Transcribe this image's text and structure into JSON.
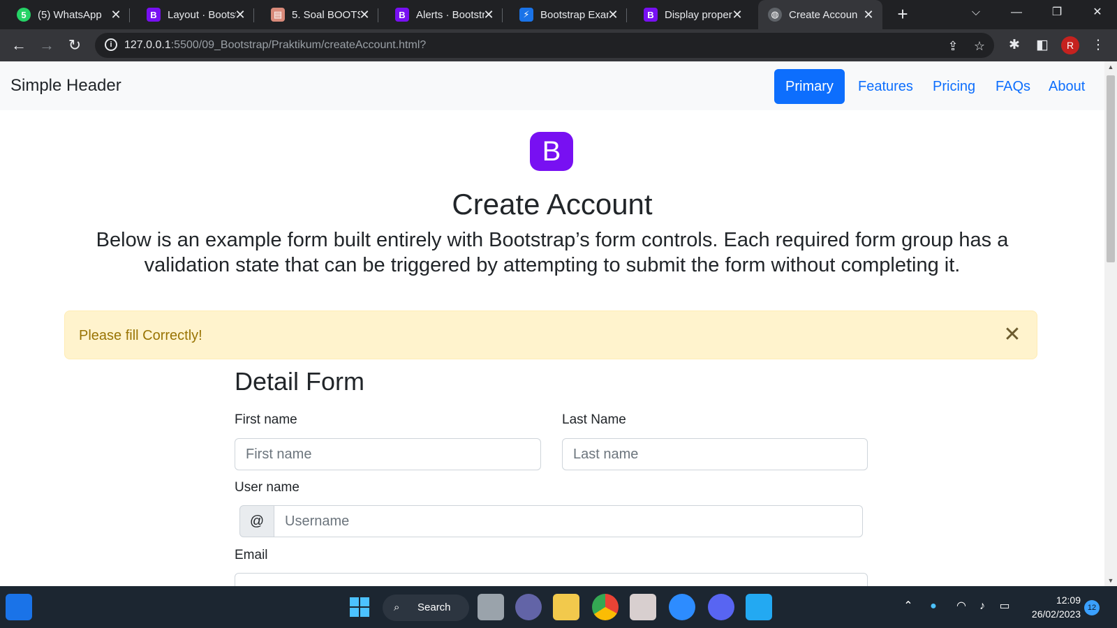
{
  "browser": {
    "tabs": [
      {
        "title": "(5) WhatsApp",
        "icon": "whatsapp-icon",
        "color": "#25d366",
        "glyph": "5"
      },
      {
        "title": "Layout · Bootst",
        "icon": "bootstrap-icon",
        "color": "#7810f2",
        "glyph": "B"
      },
      {
        "title": "5. Soal BOOTST",
        "icon": "document-icon",
        "color": "#d98a7a",
        "glyph": "▤"
      },
      {
        "title": "Alerts · Bootstr",
        "icon": "bootstrap-icon",
        "color": "#7810f2",
        "glyph": "B"
      },
      {
        "title": "Bootstrap Exan",
        "icon": "lightning-icon",
        "color": "#1a73e8",
        "glyph": "⚡"
      },
      {
        "title": "Display proper",
        "icon": "bootstrap-icon",
        "color": "#7810f2",
        "glyph": "B"
      },
      {
        "title": "Create Accoun",
        "icon": "globe-icon",
        "color": "#5f6368",
        "glyph": "◍"
      }
    ],
    "url_host": "127.0.0.1",
    "url_rest": ":5500/09_Bootstrap/Praktikum/createAccount.html?",
    "profile_initial": "R"
  },
  "page": {
    "brand": "Simple Header",
    "nav": [
      "Primary",
      "Features",
      "Pricing",
      "FAQs",
      "About"
    ],
    "logo_letter": "B",
    "title": "Create Account",
    "lead": "Below is an example form built entirely with Bootstrap’s form controls. Each required form group has a validation state that can be triggered by attempting to submit the form without completing it.",
    "alert_text": "Please fill Correctly!",
    "form_title": "Detail Form",
    "first_name_label": "First name",
    "first_name_placeholder": "First name",
    "last_name_label": "Last Name",
    "last_name_placeholder": "Last name",
    "username_label": "User name",
    "username_addon": "@",
    "username_placeholder": "Username",
    "email_label": "Email"
  },
  "taskbar": {
    "search_label": "Search",
    "time": "12:09",
    "date": "26/02/2023",
    "notifications": "12"
  }
}
